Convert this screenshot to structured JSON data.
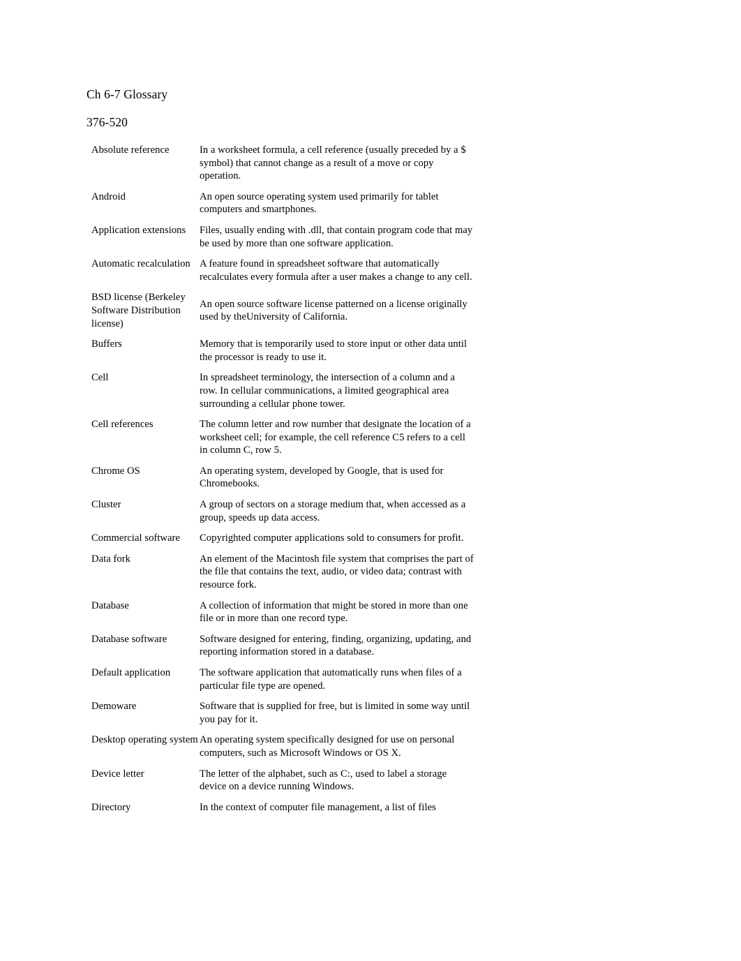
{
  "document": {
    "title": "Ch 6-7 Glossary",
    "subtitle": "376-520",
    "background_color": "#ffffff",
    "text_color": "#000000"
  },
  "glossary": {
    "entries": [
      {
        "term": "Absolute reference",
        "definition": "In a worksheet formula, a cell reference (usually preceded by a $ symbol) that cannot change as a result of a move or copy operation.",
        "center_definition": false
      },
      {
        "term": "Android",
        "definition": "An open source operating system used primarily for tablet computers and smartphones.",
        "center_definition": false
      },
      {
        "term": "Application extensions",
        "definition": "Files, usually ending with .dll, that contain program code that may be used by more than one software application.",
        "center_definition": false
      },
      {
        "term": "Automatic recalculation",
        "definition": "A feature found in spreadsheet software that automatically recalculates every formula after a user makes a change to any cell.",
        "center_definition": false
      },
      {
        "term": "BSD license (Berkeley Software Distribution license)",
        "definition": "An open source software license patterned on a license originally used by theUniversity of California.",
        "center_definition": true
      },
      {
        "term": "Buffers",
        "definition": "Memory that is temporarily used to store input or other data until the processor is ready to use it.",
        "center_definition": false
      },
      {
        "term": "Cell",
        "definition": "In spreadsheet terminology, the intersection of a column and a row. In cellular communications, a limited geographical area surrounding a cellular phone tower.",
        "center_definition": false
      },
      {
        "term": "Cell references",
        "definition": "The column letter and row number that designate the location of a worksheet cell; for example, the cell reference C5 refers to a cell in column C, row 5.",
        "center_definition": false
      },
      {
        "term": "Chrome OS",
        "definition": "An operating system, developed by Google, that is used for Chromebooks.",
        "center_definition": false
      },
      {
        "term": "Cluster",
        "definition": "A group of sectors on a storage medium that, when accessed as a group, speeds up data access.",
        "center_definition": false
      },
      {
        "term": "Commercial software",
        "definition": "Copyrighted computer applications sold to consumers for profit.",
        "center_definition": false
      },
      {
        "term": "Data fork",
        "definition": "An element of the Macintosh file system that comprises the part of the file that contains the text, audio, or video data; contrast with resource fork.",
        "center_definition": false
      },
      {
        "term": "Database",
        "definition": "A collection of information that might be stored in more than one file or in more than one record type.",
        "center_definition": false
      },
      {
        "term": "Database software",
        "definition": "Software designed for entering, finding, organizing, updating, and reporting information stored in a database.",
        "center_definition": false
      },
      {
        "term": "Default application",
        "definition": "The software application that automatically runs when files of a particular file type are opened.",
        "center_definition": false
      },
      {
        "term": "Demoware",
        "definition": "Software that is supplied for free, but is limited in some way until you pay for it.",
        "center_definition": false
      },
      {
        "term": "Desktop operating system",
        "definition": "An operating system specifically designed for use on personal computers, such as Microsoft Windows or OS X.",
        "center_definition": true
      },
      {
        "term": "Device letter",
        "definition": "The letter of the alphabet, such as C:, used to label a storage device on a device running Windows.",
        "center_definition": false
      },
      {
        "term": "Directory",
        "definition": "In the context of computer file management, a list of files",
        "center_definition": false
      }
    ]
  }
}
